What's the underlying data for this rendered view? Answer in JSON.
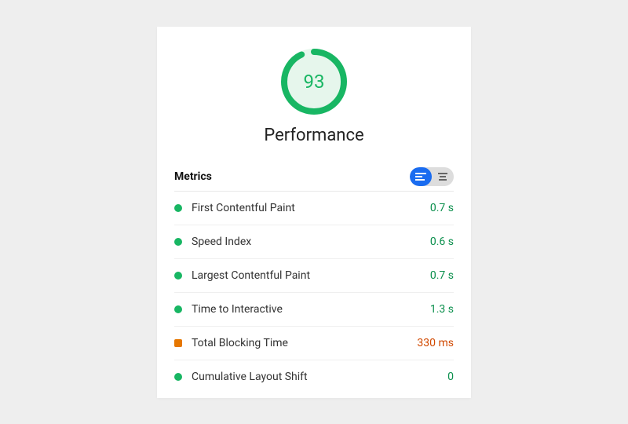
{
  "score": {
    "value": "93",
    "percent": 93,
    "title": "Performance"
  },
  "metrics_header": "Metrics",
  "colors": {
    "green": "#18b663",
    "orange": "#e67700",
    "val_green": "#0a8f4c",
    "val_orange": "#d14900",
    "accent": "#1a6cf0"
  },
  "metrics": [
    {
      "status": "green",
      "label": "First Contentful Paint",
      "value": "0.7 s",
      "value_color": "green"
    },
    {
      "status": "green",
      "label": "Speed Index",
      "value": "0.6 s",
      "value_color": "green"
    },
    {
      "status": "green",
      "label": "Largest Contentful Paint",
      "value": "0.7 s",
      "value_color": "green"
    },
    {
      "status": "green",
      "label": "Time to Interactive",
      "value": "1.3 s",
      "value_color": "green"
    },
    {
      "status": "orange",
      "label": "Total Blocking Time",
      "value": "330 ms",
      "value_color": "orange"
    },
    {
      "status": "green",
      "label": "Cumulative Layout Shift",
      "value": "0",
      "value_color": "green"
    }
  ]
}
